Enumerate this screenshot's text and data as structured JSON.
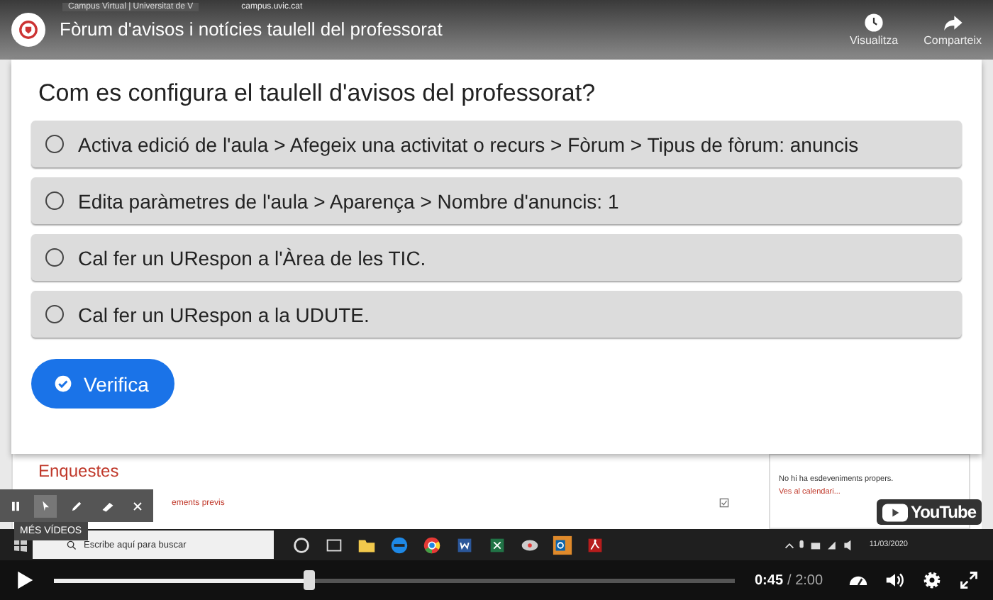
{
  "browser": {
    "tab_title": "Campus Virtual | Universitat de V",
    "url": "campus.uvic.cat"
  },
  "video": {
    "title": "Fòrum d'avisos i notícies taulell del professorat",
    "actions": [
      {
        "kind": "clock",
        "label": "Visualitza"
      },
      {
        "kind": "share",
        "label": "Comparteix"
      }
    ]
  },
  "quiz": {
    "question": "Com es configura el taulell d'avisos del professorat?",
    "options": [
      {
        "label": "Activa edició de l'aula > Afegeix una activitat o recurs > Fòrum > Tipus de fòrum: anuncis",
        "selected": false
      },
      {
        "label": "Edita paràmetres de l'aula > Aparença > Nombre d'anuncis: 1",
        "selected": false
      },
      {
        "label": "Cal fer un URespon a l'Àrea de les TIC.",
        "selected": false
      },
      {
        "label": "Cal fer un URespon a la UDUTE.",
        "selected": false
      }
    ],
    "button": "Verifica"
  },
  "background_page": {
    "section_title": "Enquestes",
    "link": "ements previs",
    "sidebar_text": "No hi ha esdeveniments propers.",
    "sidebar_link": "Ves al calendari..."
  },
  "more_videos": "MÉS VÍDEOS",
  "taskbar": {
    "search_placeholder": "Escribe aquí para buscar",
    "date": "11/03/2020"
  },
  "logo": "YouTube",
  "player": {
    "level": 0.375,
    "current_time": "0:45",
    "duration": "/ 2:00"
  }
}
